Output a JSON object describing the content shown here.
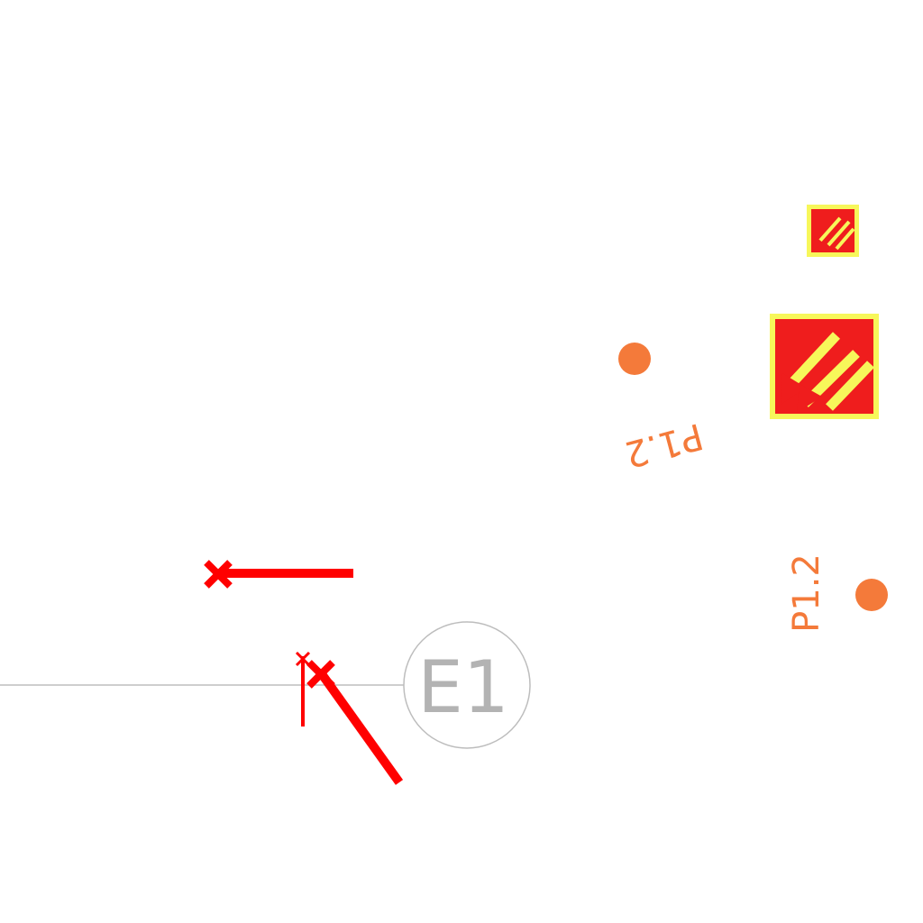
{
  "colors": {
    "background": "#ffffff",
    "grid": "#bdbdbd",
    "grid_label": "#b3b3b3",
    "wire": "#ff0000",
    "pad": "#f47a3a",
    "label": "#f47a3a",
    "emergency_sign_fill": "#ef1d1d",
    "emergency_sign_border": "#f7f75a"
  },
  "grid_marker": {
    "label": "E1"
  },
  "pins": [
    {
      "label": "P1.2",
      "orientation": "upside-down"
    },
    {
      "label": "P1.2",
      "orientation": "vertical"
    }
  ],
  "signs": [
    {
      "icon": "emergency-exit-arrow-icon",
      "size": "small"
    },
    {
      "icon": "emergency-exit-arrow-icon",
      "size": "large"
    }
  ]
}
